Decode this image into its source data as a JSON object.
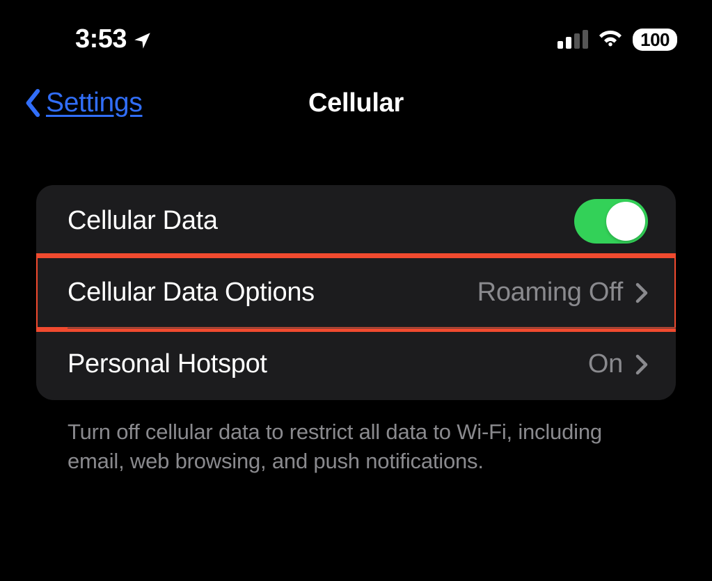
{
  "status_bar": {
    "time": "3:53",
    "battery": "100"
  },
  "nav": {
    "back_label": "Settings",
    "title": "Cellular"
  },
  "rows": {
    "cellular_data": {
      "label": "Cellular Data",
      "toggle_on": true
    },
    "cellular_data_options": {
      "label": "Cellular Data Options",
      "value": "Roaming Off"
    },
    "personal_hotspot": {
      "label": "Personal Hotspot",
      "value": "On"
    }
  },
  "footer": "Turn off cellular data to restrict all data to Wi-Fi, including email, web browsing, and push notifications."
}
